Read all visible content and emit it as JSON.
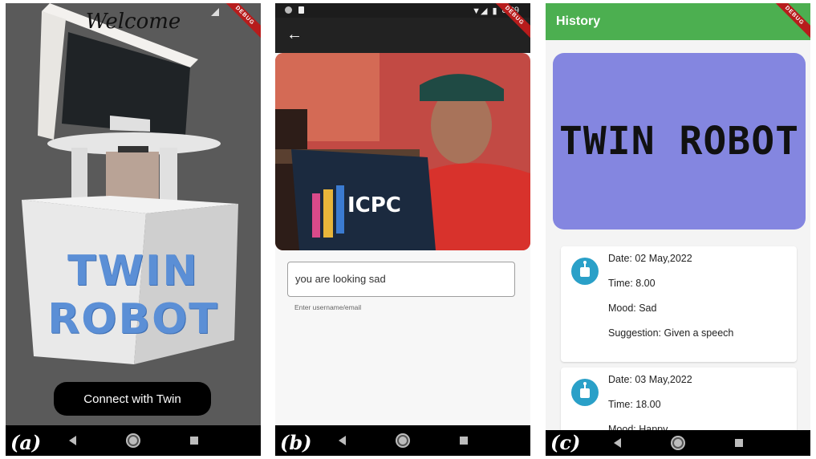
{
  "panel_a": {
    "label": "(a)",
    "title": "Welcome",
    "debug": "DEBUG",
    "brand": "TWIN ROBOT",
    "connect_label": "Connect with Twin"
  },
  "panel_b": {
    "label": "(b)",
    "time": "8:39",
    "debug": "DEBUG",
    "back_icon": "arrow-left-icon",
    "photo_text": "ICPC",
    "input_value": "you are looking sad",
    "helper_text": "Enter username/email"
  },
  "panel_c": {
    "label": "(c)",
    "title": "History",
    "debug": "DEBUG",
    "banner_text": "TWIN ROBOT",
    "entries": [
      {
        "date": "Date: 02 May,2022",
        "time": "Time: 8.00",
        "mood": "Mood: Sad",
        "suggestion": "Suggestion: Given a speech"
      },
      {
        "date": "Date: 03 May,2022",
        "time": "Time: 18.00",
        "mood": "Mood: Happy"
      }
    ]
  },
  "colors": {
    "green_appbar": "#4caf50",
    "banner": "#8486e0",
    "icon_blue": "#2aa0c8",
    "brand_blue": "#5b8fd6"
  }
}
